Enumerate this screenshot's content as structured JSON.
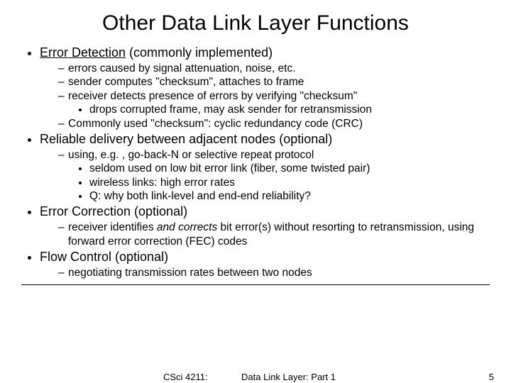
{
  "title": "Other Data Link Layer Functions",
  "sections": [
    {
      "heading_pre": "Error Detection",
      "heading_post": " (commonly implemented)",
      "dashes": [
        {
          "text": "errors caused by signal attenuation, noise, etc."
        },
        {
          "text": "sender computes \"checksum\", attaches to frame"
        },
        {
          "text": "receiver detects presence of errors by verifying \"checksum\"",
          "dots": [
            "drops corrupted frame, may ask sender for retransmission"
          ]
        },
        {
          "text": "Commonly used \"checksum\": cyclic redundancy code (CRC)"
        }
      ]
    },
    {
      "heading_pre": "",
      "heading_post": "Reliable delivery between adjacent nodes (optional)",
      "dashes": [
        {
          "text": "using, e.g. , go-back-N or selective repeat protocol",
          "dots": [
            "seldom used on low bit error link (fiber, some twisted pair)",
            "wireless links: high error rates",
            "Q: why both link-level and end-end reliability?"
          ]
        }
      ]
    },
    {
      "heading_pre": "",
      "heading_post": "Error Correction (optional)",
      "dashes": [
        {
          "text_pre": "receiver identifies ",
          "text_ital": "and corrects",
          "text_post": " bit error(s) without resorting to retransmission, using forward error correction (FEC) codes"
        }
      ]
    },
    {
      "heading_pre": "",
      "heading_post": "Flow Control (optional)",
      "dashes": [
        {
          "text": "negotiating transmission rates between two nodes"
        }
      ]
    }
  ],
  "footer": {
    "course": "CSci 4211:",
    "subtitle": "Data Link Layer: Part 1",
    "page": "5"
  }
}
